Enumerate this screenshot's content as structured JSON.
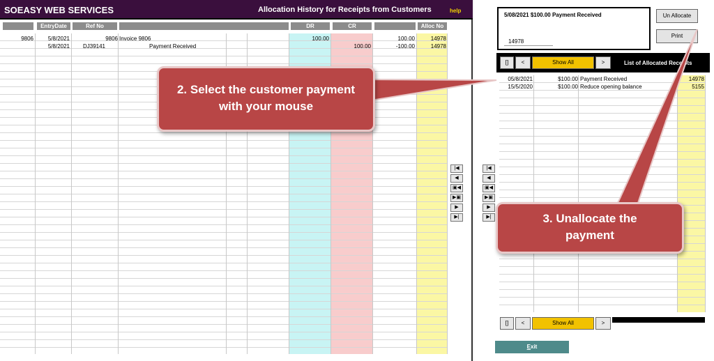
{
  "header": {
    "company": "SOEASY WEB SERVICES",
    "title": "Allocation History for Receipts from Customers",
    "help": "help"
  },
  "left_table": {
    "columns": [
      "EntryDate",
      "Ref No",
      "DR",
      "CR",
      "Alloc No"
    ],
    "rows": [
      {
        "id": "9806",
        "date": "5/8/2021",
        "ref_num": "9806",
        "ref_desc": "Invoice 9806",
        "dr": "100.00",
        "cr": "",
        "balance": "100.00",
        "alloc": "14978"
      },
      {
        "id": "",
        "date": "5/8/2021",
        "ref_num": "DJ39141",
        "ref_desc": "Payment Received",
        "dr": "",
        "cr": "100.00",
        "balance": "-100.00",
        "alloc": "14978"
      }
    ]
  },
  "nav_buttons": [
    "|◀",
    "◀",
    "▣◀",
    "▶▣",
    "▶",
    "▶|"
  ],
  "detail": {
    "text": "5/08/2021 $100.00 Payment Received",
    "alloc_no": "14978"
  },
  "buttons": {
    "unallocate": "Un Allocate",
    "print": "Print",
    "first": "[]",
    "prev": "<",
    "show_all": "Show All",
    "next": ">",
    "exit_first": "E",
    "exit_rest": "xit"
  },
  "list_title": "List of Allocated Receipts",
  "right_table": {
    "rows": [
      {
        "date": "05/8/2021",
        "amount": "$100.00",
        "desc": "Payment Received",
        "alloc": "14978"
      },
      {
        "date": "15/5/2020",
        "amount": "$100.00",
        "desc": "Reduce opening balance",
        "alloc": "5155"
      }
    ]
  },
  "callouts": {
    "select": "2. Select the customer payment with your mouse",
    "unallocate": "3. Unallocate the payment"
  },
  "colors": {
    "title_bar": "#3a0f3d",
    "dr_column": "#c8f4f4",
    "cr_column": "#f8cccc",
    "alloc_column": "#fbf7a4",
    "callout": "#b84646",
    "show_all": "#f2c200"
  }
}
